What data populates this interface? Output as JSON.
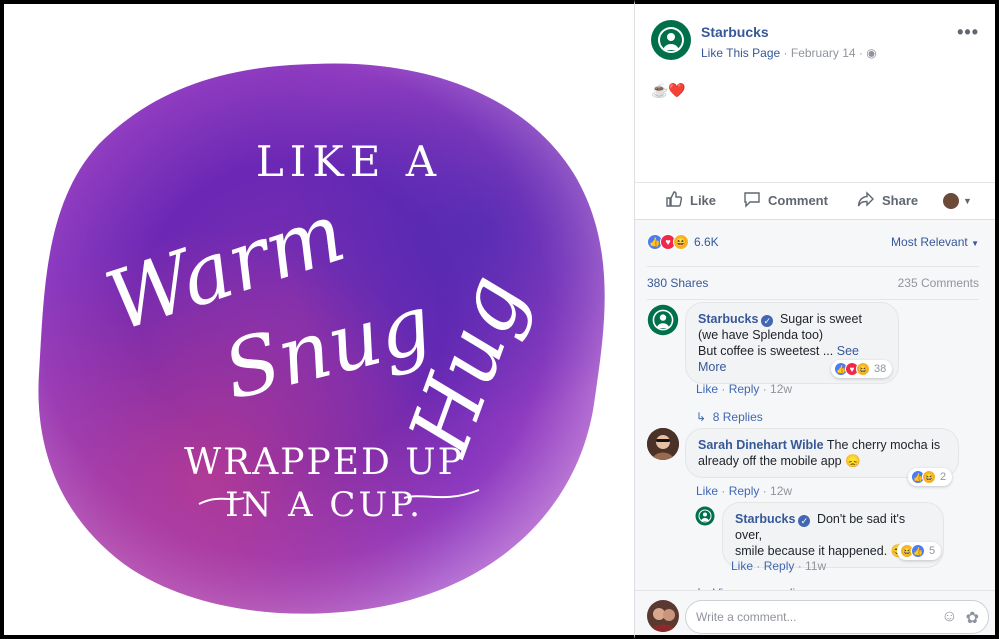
{
  "photo": {
    "line1": "LIKE A",
    "line2": "Warm",
    "line3": "Snug",
    "line4": "Hug",
    "line5": "WRAPPED UP",
    "line6": "IN A CUP."
  },
  "post": {
    "page_name": "Starbucks",
    "like_page": "Like This Page",
    "date": "February 14",
    "separator": "·",
    "more": "•••",
    "text_emoji": "☕❤️"
  },
  "actions": {
    "like": "Like",
    "comment": "Comment",
    "share": "Share"
  },
  "feedback": {
    "reactions_count": "6.6K",
    "sort": "Most Relevant",
    "shares": "380 Shares",
    "comments": "235 Comments"
  },
  "comments": [
    {
      "name": "Starbucks",
      "text_line1": "Sugar is sweet",
      "text_line2": "(we have Splenda too)",
      "text_line3": "But coffee is sweetest ...",
      "see_more": "See More",
      "like": "Like",
      "reply": "Reply",
      "age": "12w",
      "react_count": "38",
      "replies": "8 Replies"
    },
    {
      "name": "Sarah Dinehart Wible",
      "text_line1": "The cherry mocha is",
      "text_line2": "already off the mobile app",
      "emoji": "😞",
      "like": "Like",
      "reply": "Reply",
      "age": "12w",
      "react_count": "2"
    },
    {
      "name": "Starbucks",
      "text_line1": "Don't be sad it's over,",
      "text_line2": "smile because it happened.",
      "emoji": "😊",
      "like": "Like",
      "reply": "Reply",
      "age": "11w",
      "react_count": "5",
      "view_more": "View more replies"
    }
  ],
  "composer": {
    "placeholder": "Write a comment..."
  },
  "colors": {
    "link": "#365899",
    "brand_green": "#00704a",
    "like_blue": "#4a7cf6",
    "love_red": "#f0284a"
  }
}
